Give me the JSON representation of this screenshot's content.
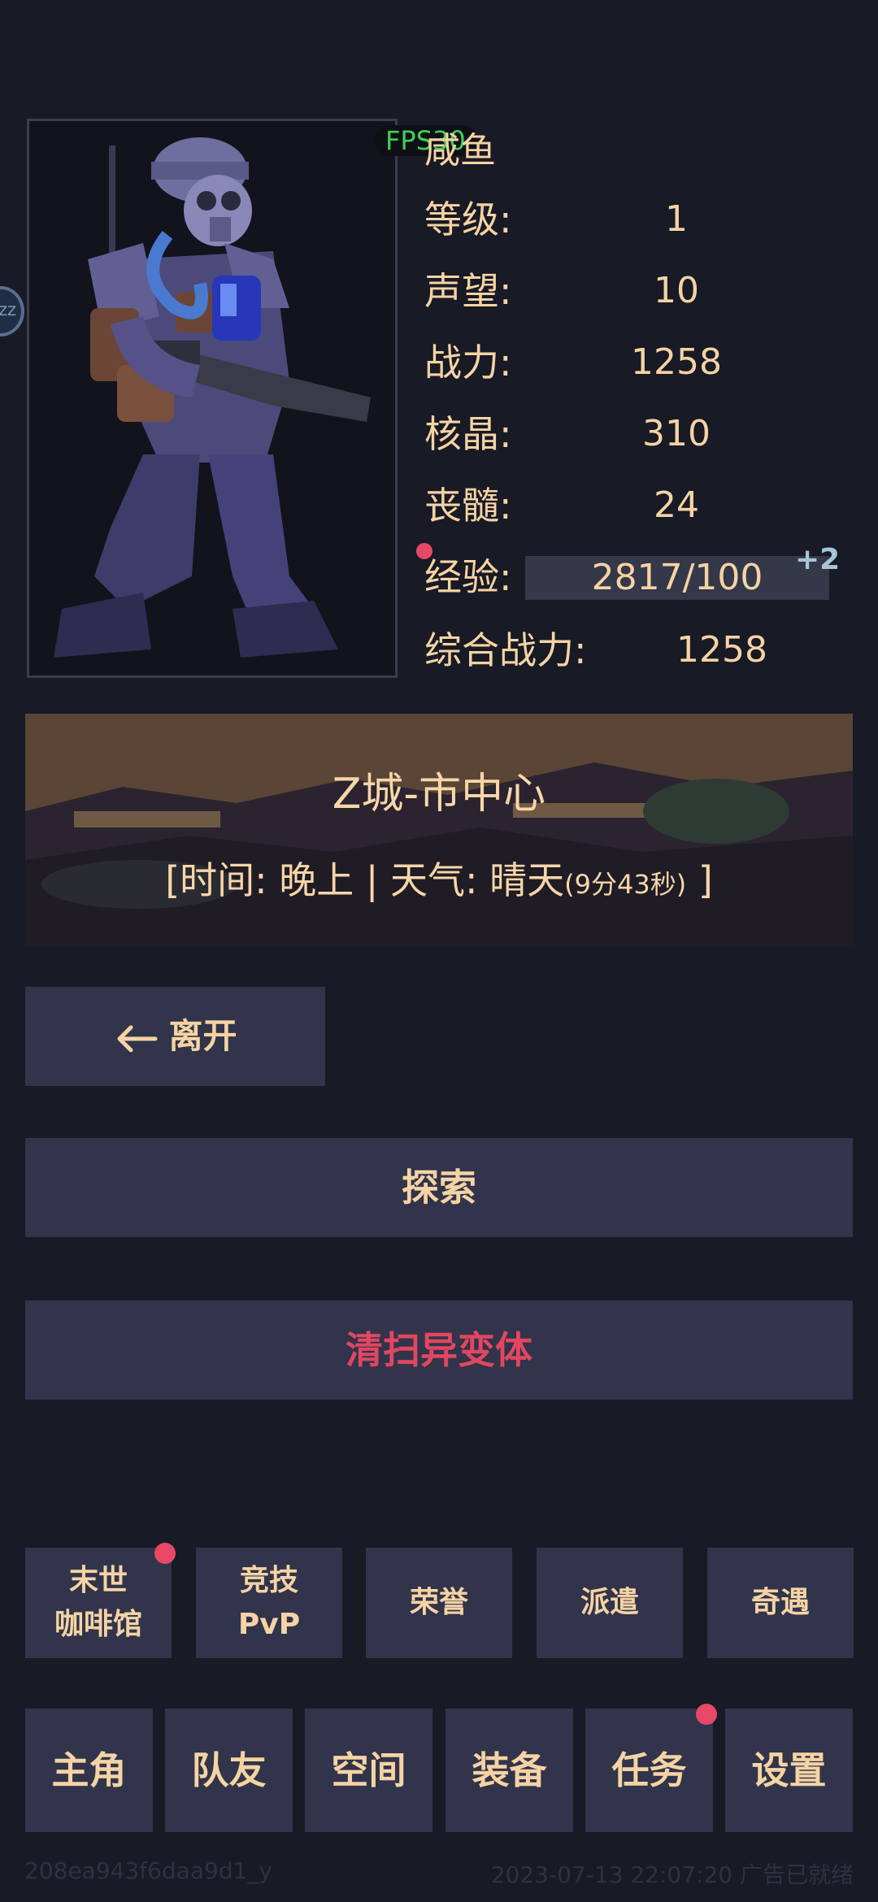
{
  "fps": "FPS30",
  "side_handle": "ZZ",
  "character": {
    "name": "咸鱼",
    "stats": [
      {
        "label": "等级:",
        "value": "1"
      },
      {
        "label": "声望:",
        "value": "10"
      },
      {
        "label": "战力:",
        "value": "1258"
      },
      {
        "label": "核晶:",
        "value": "310"
      },
      {
        "label": "丧髓:",
        "value": "24"
      }
    ],
    "exp": {
      "label": "经验:",
      "value": "2817/100",
      "bonus": "+2"
    },
    "total_power": {
      "label": "综合战力:",
      "value": "1258"
    }
  },
  "location": {
    "title": "Z城-市中心",
    "info_prefix": "[时间: 晚上 | 天气: 晴天",
    "info_timer": "(9分43秒)",
    "info_suffix": " ]"
  },
  "actions": {
    "leave": "离开",
    "explore": "探索",
    "clear": "清扫异变体"
  },
  "menu_row1": [
    "末世\n咖啡馆",
    "竞技\nPvP",
    "荣誉",
    "派遣",
    "奇遇"
  ],
  "menu_row2": [
    "主角",
    "队友",
    "空间",
    "装备",
    "任务",
    "设置"
  ],
  "footer": {
    "id": "208ea943f6daa9d1_y",
    "time": "2023-07-13 22:07:20 广告已就绪"
  },
  "colors": {
    "background": "#181a25",
    "button": "#31344a",
    "text": "#f5d3a4",
    "danger": "#e24661",
    "badge": "#e84868",
    "fps": "#3fcf5a"
  }
}
